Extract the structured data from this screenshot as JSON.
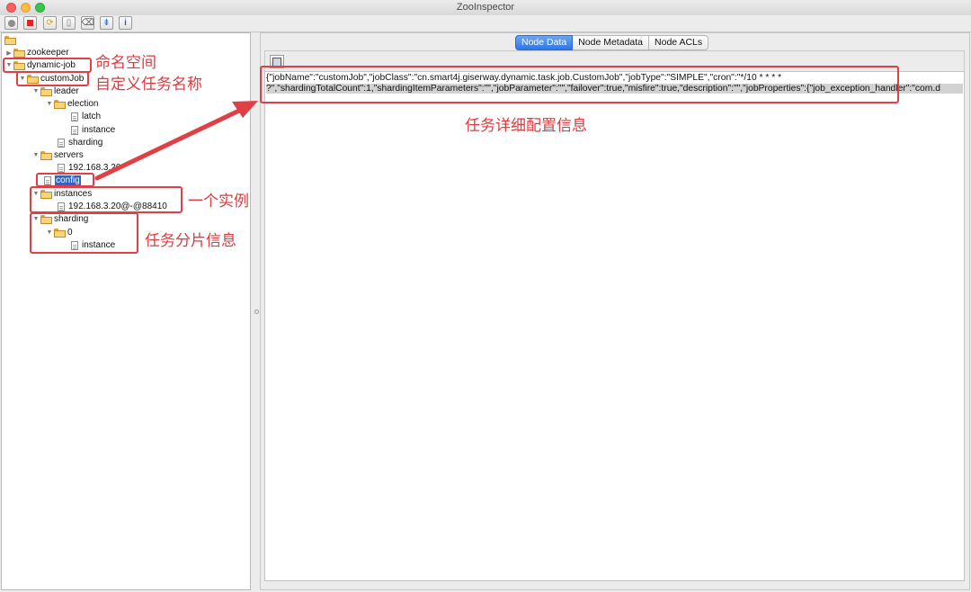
{
  "window": {
    "title": "ZooInspector"
  },
  "toolbar": {
    "buttons": [
      "connect-icon",
      "disconnect-icon",
      "refresh-icon",
      "add-node-icon",
      "delete-node-icon",
      "add-watch-icon",
      "info-icon"
    ]
  },
  "tree": {
    "nodes": [
      {
        "label": "zookeeper"
      },
      {
        "label": "dynamic-job"
      },
      {
        "label": "customJob"
      },
      {
        "label": "leader"
      },
      {
        "label": "election"
      },
      {
        "label": "latch"
      },
      {
        "label": "instance"
      },
      {
        "label": "sharding"
      },
      {
        "label": "servers"
      },
      {
        "label": "192.168.3.20"
      },
      {
        "label": "config"
      },
      {
        "label": "instances"
      },
      {
        "label": "192.168.3.20@-@88410"
      },
      {
        "label": "sharding"
      },
      {
        "label": "0"
      },
      {
        "label": "instance"
      }
    ]
  },
  "tabs": [
    "Node Data",
    "Node Metadata",
    "Node ACLs"
  ],
  "active_tab": "Node Data",
  "node_data": {
    "line1": "{\"jobName\":\"customJob\",\"jobClass\":\"cn.smart4j.giserway.dynamic.task.job.CustomJob\",\"jobType\":\"SIMPLE\",\"cron\":\"*/10 * * * *",
    "line2": "?\",\"shardingTotalCount\":1,\"shardingItemParameters\":\"\",\"jobParameter\":\"\",\"failover\":true,\"misfire\":true,\"description\":\"\",\"jobProperties\":{\"job_exception_handler\":\"com.d"
  },
  "annotations": {
    "namespace": "命名空间",
    "custom_job": "自定义任务名称",
    "job_config": "任务详细配置信息",
    "instance": "一个实例",
    "sharding": "任务分片信息"
  },
  "colors": {
    "annotation": "#e04045",
    "tab_active": "#2f76e6",
    "selection": "#2d63cf"
  }
}
